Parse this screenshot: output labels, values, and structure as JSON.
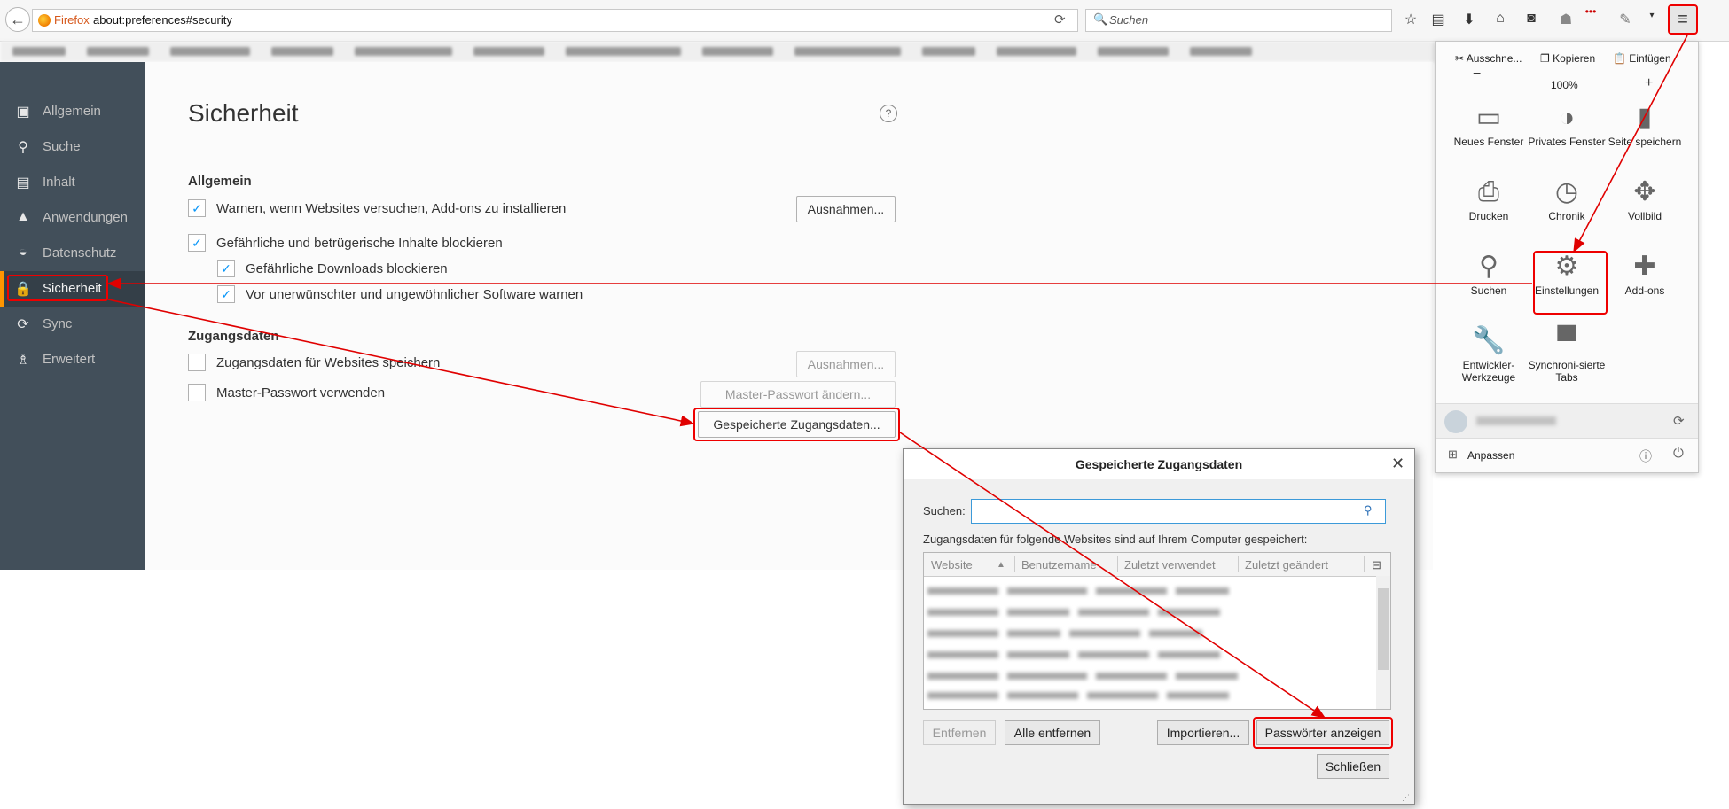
{
  "browser": {
    "brand": "Firefox",
    "url": "about:preferences#security",
    "search_placeholder": "Suchen",
    "dots": "•••"
  },
  "sidebar": {
    "items": [
      {
        "label": "Allgemein",
        "icon": "general-icon"
      },
      {
        "label": "Suche",
        "icon": "search-icon"
      },
      {
        "label": "Inhalt",
        "icon": "content-icon"
      },
      {
        "label": "Anwendungen",
        "icon": "rocket-icon"
      },
      {
        "label": "Datenschutz",
        "icon": "mask-icon"
      },
      {
        "label": "Sicherheit",
        "icon": "lock-icon"
      },
      {
        "label": "Sync",
        "icon": "sync-icon"
      },
      {
        "label": "Erweitert",
        "icon": "wizard-hat-icon"
      }
    ]
  },
  "main": {
    "title": "Sicherheit",
    "general": {
      "heading": "Allgemein",
      "warn_addons": "Warnen, wenn Websites versuchen, Add-ons zu installieren",
      "exceptions": "Ausnahmen...",
      "block_dangerous": "Gefährliche und betrügerische Inhalte blockieren",
      "block_downloads": "Gefährliche Downloads blockieren",
      "warn_software": "Vor unerwünschter und ungewöhnlicher Software warnen"
    },
    "logins": {
      "heading": "Zugangsdaten",
      "save_logins": "Zugangsdaten für Websites speichern",
      "exceptions": "Ausnahmen...",
      "master_password": "Master-Passwort verwenden",
      "change_master": "Master-Passwort ändern...",
      "saved_logins": "Gespeicherte Zugangsdaten..."
    }
  },
  "menu": {
    "cut": "Ausschne...",
    "copy": "Kopieren",
    "paste": "Einfügen",
    "zoom_out": "−",
    "zoom": "100%",
    "zoom_in": "+",
    "items": [
      {
        "label": "Neues Fenster",
        "icon": "new-window-icon"
      },
      {
        "label": "Privates Fenster",
        "icon": "private-window-icon"
      },
      {
        "label": "Seite speichern",
        "icon": "save-page-icon"
      },
      {
        "label": "Drucken",
        "icon": "print-icon"
      },
      {
        "label": "Chronik",
        "icon": "history-icon"
      },
      {
        "label": "Vollbild",
        "icon": "fullscreen-icon"
      },
      {
        "label": "Suchen",
        "icon": "find-icon"
      },
      {
        "label": "Einstellungen",
        "icon": "gear-icon"
      },
      {
        "label": "Add-ons",
        "icon": "puzzle-icon"
      },
      {
        "label": "Entwickler-Werkzeuge",
        "icon": "wrench-icon"
      },
      {
        "label": "Synchroni-sierte Tabs",
        "icon": "synced-tabs-icon"
      }
    ],
    "customize": "Anpassen"
  },
  "dialog": {
    "title": "Gespeicherte Zugangsdaten",
    "search_label": "Suchen:",
    "info": "Zugangsdaten für folgende Websites sind auf Ihrem Computer gespeichert:",
    "columns": [
      "Website",
      "Benutzername",
      "Zuletzt verwendet",
      "Zuletzt geändert"
    ],
    "remove": "Entfernen",
    "remove_all": "Alle entfernen",
    "import": "Importieren...",
    "show_passwords": "Passwörter anzeigen",
    "close": "Schließen"
  },
  "colors": {
    "annotation": "#e00000",
    "sidebar_bg": "#424f5a",
    "active_accent": "#ff9500",
    "checkbox": "#0996f8"
  }
}
